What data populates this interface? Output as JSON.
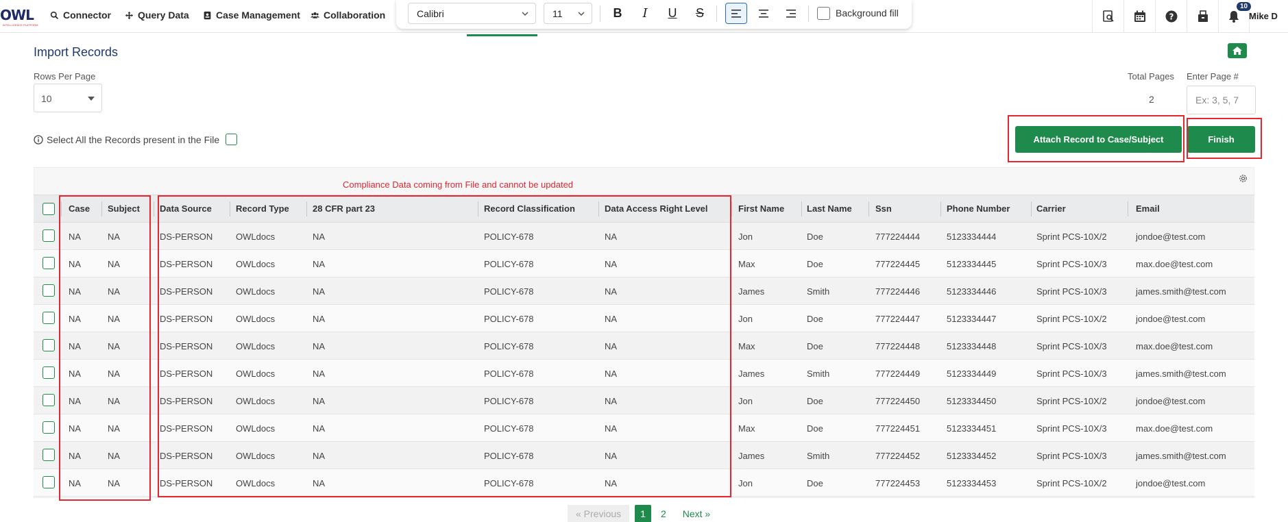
{
  "nav": {
    "logo_text": "OWL",
    "logo_sub": "INTELLIGENCE PLATFORM",
    "items": [
      {
        "label": "Connector",
        "icon": "search-icon"
      },
      {
        "label": "Query Data",
        "icon": "move-icon"
      },
      {
        "label": "Case Management",
        "icon": "badge-icon"
      },
      {
        "label": "Collaboration",
        "icon": "users-icon"
      }
    ],
    "notification_count": "10",
    "user_name": "Mike D"
  },
  "toolbar": {
    "font_family": "Calibri",
    "font_size": "11",
    "bold": "B",
    "italic": "I",
    "underline": "U",
    "strike": "S",
    "background_fill_label": "Background fill"
  },
  "page": {
    "title": "Import Records",
    "rows_per_page_label": "Rows Per Page",
    "rows_per_page_value": "10",
    "total_pages_label": "Total Pages",
    "total_pages_value": "2",
    "enter_page_label": "Enter Page #",
    "enter_page_placeholder": "Ex: 3, 5, 7",
    "select_all_label": "Select All the Records present in the File",
    "attach_button": "Attach Record to Case/Subject",
    "finish_button": "Finish",
    "compliance_note": "Compliance Data coming from File and cannot be updated"
  },
  "table": {
    "columns": [
      "Case",
      "Subject",
      "Data Source",
      "Record Type",
      "28 CFR part 23",
      "Record Classification",
      "Data Access Right Level",
      "First Name",
      "Last Name",
      "Ssn",
      "Phone Number",
      "Carrier",
      "Email"
    ],
    "rows": [
      [
        "NA",
        "NA",
        "DS-PERSON",
        "OWLdocs",
        "NA",
        "POLICY-678",
        "NA",
        "Jon",
        "Doe",
        "777224444",
        "5123334444",
        "Sprint PCS-10X/2",
        "jondoe@test.com"
      ],
      [
        "NA",
        "NA",
        "DS-PERSON",
        "OWLdocs",
        "NA",
        "POLICY-678",
        "NA",
        "Max",
        "Doe",
        "777224445",
        "5123334445",
        "Sprint PCS-10X/3",
        "max.doe@test.com"
      ],
      [
        "NA",
        "NA",
        "DS-PERSON",
        "OWLdocs",
        "NA",
        "POLICY-678",
        "NA",
        "James",
        "Smith",
        "777224446",
        "5123334446",
        "Sprint PCS-10X/3",
        "james.smith@test.com"
      ],
      [
        "NA",
        "NA",
        "DS-PERSON",
        "OWLdocs",
        "NA",
        "POLICY-678",
        "NA",
        "Jon",
        "Doe",
        "777224447",
        "5123334447",
        "Sprint PCS-10X/2",
        "jondoe@test.com"
      ],
      [
        "NA",
        "NA",
        "DS-PERSON",
        "OWLdocs",
        "NA",
        "POLICY-678",
        "NA",
        "Max",
        "Doe",
        "777224448",
        "5123334448",
        "Sprint PCS-10X/3",
        "max.doe@test.com"
      ],
      [
        "NA",
        "NA",
        "DS-PERSON",
        "OWLdocs",
        "NA",
        "POLICY-678",
        "NA",
        "James",
        "Smith",
        "777224449",
        "5123334449",
        "Sprint PCS-10X/3",
        "james.smith@test.com"
      ],
      [
        "NA",
        "NA",
        "DS-PERSON",
        "OWLdocs",
        "NA",
        "POLICY-678",
        "NA",
        "Jon",
        "Doe",
        "777224450",
        "5123334450",
        "Sprint PCS-10X/2",
        "jondoe@test.com"
      ],
      [
        "NA",
        "NA",
        "DS-PERSON",
        "OWLdocs",
        "NA",
        "POLICY-678",
        "NA",
        "Max",
        "Doe",
        "777224451",
        "5123334451",
        "Sprint PCS-10X/3",
        "max.doe@test.com"
      ],
      [
        "NA",
        "NA",
        "DS-PERSON",
        "OWLdocs",
        "NA",
        "POLICY-678",
        "NA",
        "James",
        "Smith",
        "777224452",
        "5123334452",
        "Sprint PCS-10X/3",
        "james.smith@test.com"
      ],
      [
        "NA",
        "NA",
        "DS-PERSON",
        "OWLdocs",
        "NA",
        "POLICY-678",
        "NA",
        "Jon",
        "Doe",
        "777224453",
        "5123334453",
        "Sprint PCS-10X/2",
        "jondoe@test.com"
      ]
    ]
  },
  "pagination": {
    "previous": "« Previous",
    "pages": [
      "1",
      "2"
    ],
    "active_page": "1",
    "next": "Next »"
  },
  "colors": {
    "accent_green": "#1e8a4c",
    "highlight_red": "#e3262f",
    "title_navy": "#1f3a6b"
  }
}
